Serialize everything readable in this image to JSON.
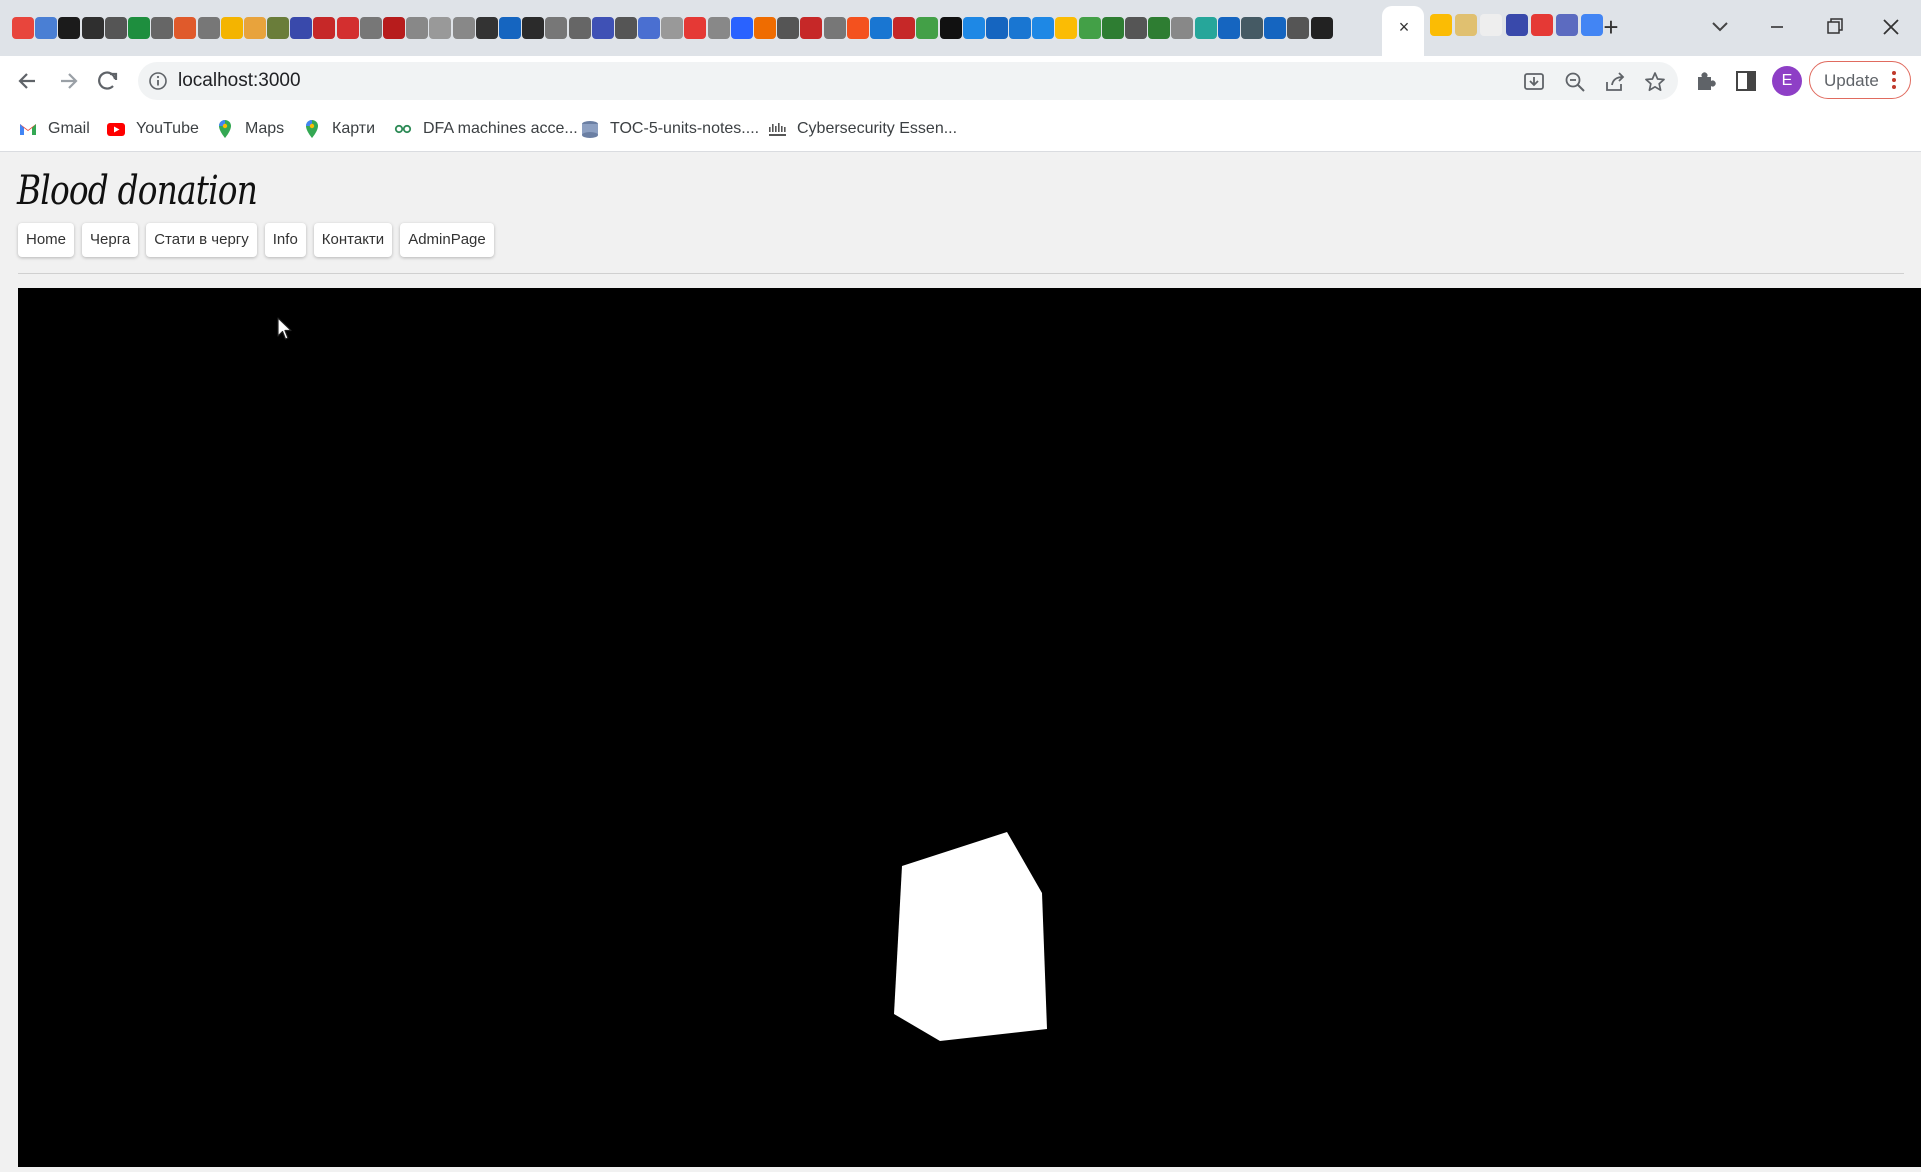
{
  "browser": {
    "tab_close_glyph": "×",
    "new_tab_glyph": "+",
    "address": "localhost:3000",
    "update_label": "Update",
    "profile_initial": "E",
    "accent_update_border": "#e06b5f",
    "avatar_color": "#8e3fc6"
  },
  "bookmarks": [
    {
      "label": "Gmail",
      "icon": "gmail-icon"
    },
    {
      "label": "YouTube",
      "icon": "youtube-icon"
    },
    {
      "label": "Maps",
      "icon": "maps-pin-icon"
    },
    {
      "label": "Карти",
      "icon": "maps-pin-icon"
    },
    {
      "label": "DFA machines acce...",
      "icon": "dfa-icon"
    },
    {
      "label": "TOC-5-units-notes....",
      "icon": "notes-icon"
    },
    {
      "label": "Cybersecurity Essen...",
      "icon": "cisco-icon"
    }
  ],
  "page": {
    "brand": "Blood donation",
    "nav": [
      "Home",
      "Черга",
      "Стати в чергу",
      "Info",
      "Контакти",
      "AdminPage"
    ],
    "canvas_background": "#000000",
    "cube_color": "#ffffff"
  }
}
